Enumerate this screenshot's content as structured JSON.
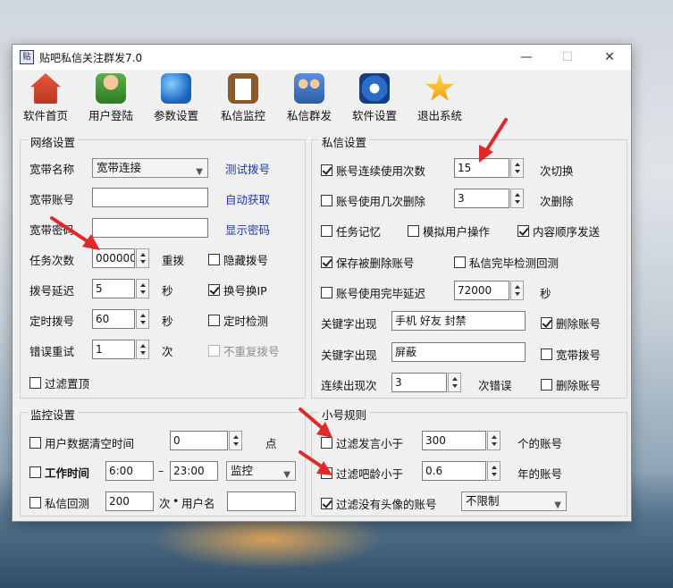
{
  "window": {
    "title": "贴吧私信关注群发7.0",
    "app_icon_text": "贴",
    "min_glyph": "—",
    "max_glyph": "☐",
    "close_glyph": "✕"
  },
  "toolbar": [
    {
      "label": "软件首页",
      "icon": "home-icon"
    },
    {
      "label": "用户登陆",
      "icon": "user-icon"
    },
    {
      "label": "参数设置",
      "icon": "globe-icon"
    },
    {
      "label": "私信监控",
      "icon": "clipboard-icon"
    },
    {
      "label": "私信群发",
      "icon": "group-icon"
    },
    {
      "label": "软件设置",
      "icon": "gear-icon"
    },
    {
      "label": "退出系统",
      "icon": "star-icon"
    }
  ],
  "network": {
    "title": "网络设置",
    "broadband_name_label": "宽带名称",
    "broadband_name_value": "宽带连接",
    "test_dial_link": "测试拨号",
    "account_label": "宽带账号",
    "account_value": "",
    "auto_fetch_link": "自动获取",
    "password_label": "宽带密码",
    "password_value": "",
    "show_password_link": "显示密码",
    "task_count_label": "任务次数",
    "task_count_value": "000000",
    "redial_label": "重拨",
    "hide_dial": {
      "label": "隐藏拨号",
      "checked": false
    },
    "dial_delay_label": "拨号延迟",
    "dial_delay_value": "5",
    "seconds1": "秒",
    "change_ip": {
      "label": "换号换IP",
      "checked": true
    },
    "timed_dial_label": "定时拨号",
    "timed_dial_value": "60",
    "seconds2": "秒",
    "timed_check": {
      "label": "定时检测",
      "checked": false
    },
    "retry_label": "错误重试",
    "retry_value": "1",
    "times_unit": "次",
    "no_repeat_dial": {
      "label": "不重复拨号",
      "checked": false
    },
    "filter_top": {
      "label": "过滤置顶",
      "checked": false
    }
  },
  "monitor": {
    "title": "监控设置",
    "clear_time": {
      "label": "用户数据清空时间",
      "checked": false
    },
    "clear_time_value": "0",
    "clear_unit": "点",
    "work_time": {
      "label": "工作时间",
      "checked": false
    },
    "work_start": "6:00",
    "dash": "–",
    "work_end": "23:00",
    "mode_value": "监控",
    "pm_reply": {
      "label": "私信回测",
      "checked": false
    },
    "pm_reply_value": "200",
    "pm_reply_unit": "次",
    "username_label": "用户名",
    "username_value": ""
  },
  "pm": {
    "title": "私信设置",
    "account_use": {
      "label": "账号连续使用次数",
      "checked": true
    },
    "account_use_value": "15",
    "switch_label": "次切换",
    "delete_after": {
      "label": "账号使用几次删除",
      "checked": false
    },
    "delete_after_value": "3",
    "delete_label": "次删除",
    "task_memory": {
      "label": "任务记忆",
      "checked": false
    },
    "simulate_user": {
      "label": "模拟用户操作",
      "checked": false
    },
    "content_order": {
      "label": "内容顺序发送",
      "checked": true
    },
    "save_deleted": {
      "label": "保存被删除账号",
      "checked": true
    },
    "pm_done_check": {
      "label": "私信完毕检测回测",
      "checked": false
    },
    "delay_after": {
      "label": "账号使用完毕延迟",
      "checked": false
    },
    "delay_value": "72000",
    "delay_unit": "秒",
    "keyword1_label": "关键字出现",
    "keyword1_value": "手机 好友 封禁",
    "delete_account1": {
      "label": "删除账号",
      "checked": true
    },
    "keyword2_label": "关键字出现",
    "keyword2_value": "屏蔽",
    "broadband_dial": {
      "label": "宽带拨号",
      "checked": false
    },
    "consecutive_label": "连续出现次",
    "consecutive_value": "3",
    "error_label": "次错误",
    "delete_account2": {
      "label": "删除账号",
      "checked": false
    }
  },
  "small_rules": {
    "title": "小号规则",
    "filter_posts": {
      "label": "过滤发言小于",
      "checked": false
    },
    "posts_value": "300",
    "posts_unit": "个的账号",
    "filter_age": {
      "label": "过滤吧龄小于",
      "checked": false
    },
    "age_value": "0.6",
    "age_unit": "年的账号",
    "filter_avatar": {
      "label": "过滤没有头像的账号",
      "checked": true
    },
    "avatar_mode": "不限制"
  },
  "colors": {
    "link": "#1a39a8",
    "arrow": "#e0292b"
  }
}
